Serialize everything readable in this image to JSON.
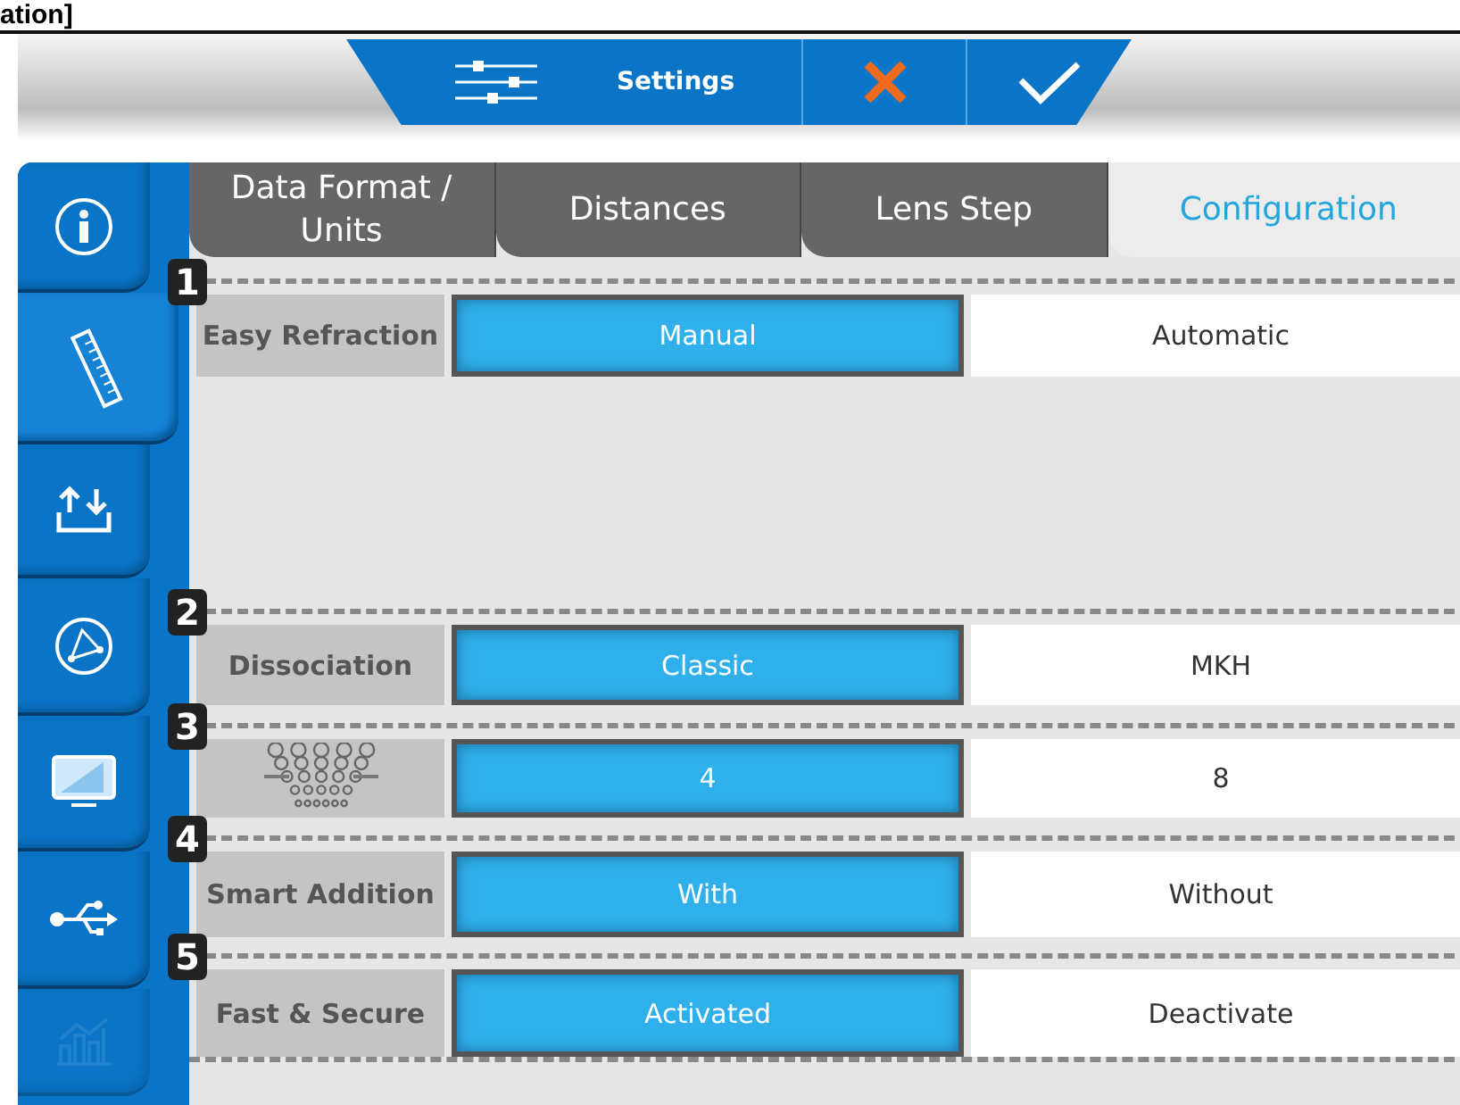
{
  "caption_fragment": "ation]",
  "toolbar": {
    "title": "Settings"
  },
  "sidebar": {
    "items": [
      {
        "selected": false,
        "disabled": false
      },
      {
        "selected": true,
        "disabled": false
      },
      {
        "selected": false,
        "disabled": false
      },
      {
        "selected": false,
        "disabled": false
      },
      {
        "selected": false,
        "disabled": false
      },
      {
        "selected": false,
        "disabled": false
      },
      {
        "selected": false,
        "disabled": true
      }
    ]
  },
  "tabs": [
    {
      "label": "Data Format /\nUnits",
      "selected": false
    },
    {
      "label": "Distances",
      "selected": false
    },
    {
      "label": "Lens Step",
      "selected": false
    },
    {
      "label": "Configuration",
      "selected": true
    }
  ],
  "sections": [
    {
      "number": "1",
      "kind": "text",
      "label": "Easy Refraction",
      "options": [
        {
          "label": "Manual",
          "selected": true
        },
        {
          "label": "Automatic",
          "selected": false
        }
      ]
    },
    {
      "number": "2",
      "kind": "text",
      "label": "Dissociation",
      "options": [
        {
          "label": "Classic",
          "selected": true
        },
        {
          "label": "MKH",
          "selected": false
        }
      ]
    },
    {
      "number": "3",
      "kind": "chart",
      "options": [
        {
          "label": "4",
          "selected": true
        },
        {
          "label": "8",
          "selected": false
        }
      ]
    },
    {
      "number": "4",
      "kind": "text",
      "label": "Smart Addition",
      "options": [
        {
          "label": "With",
          "selected": true
        },
        {
          "label": "Without",
          "selected": false
        }
      ]
    },
    {
      "number": "5",
      "kind": "text",
      "label": "Fast & Secure",
      "options": [
        {
          "label": "Activated",
          "selected": true
        },
        {
          "label": "Deactivate",
          "selected": false
        }
      ]
    }
  ]
}
